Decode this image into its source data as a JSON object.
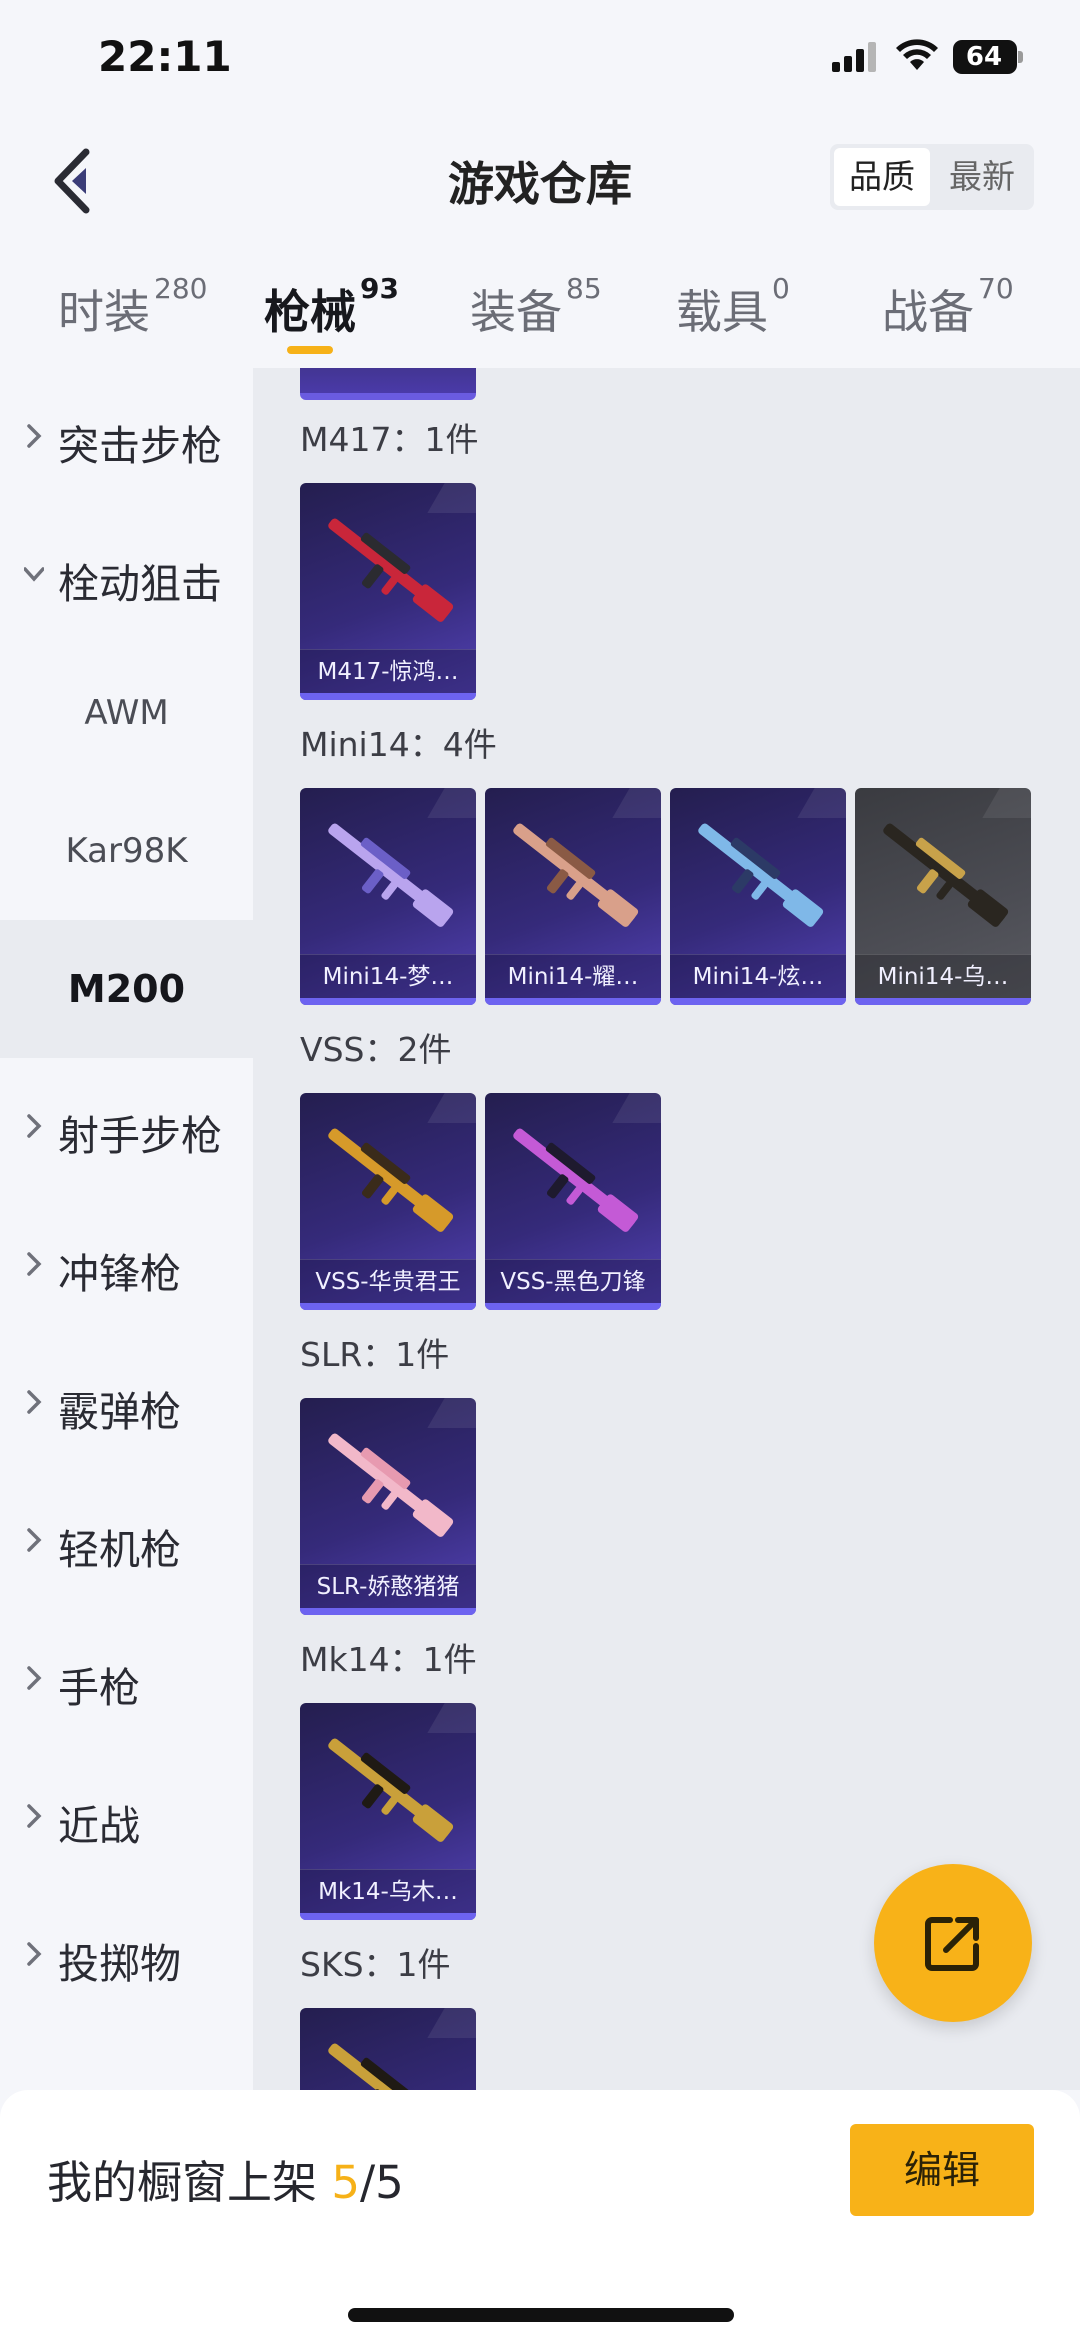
{
  "status_bar": {
    "time": "22:11",
    "battery": "64"
  },
  "header": {
    "title": "游戏仓库",
    "sort_options": [
      "品质",
      "最新"
    ],
    "sort_active": "品质"
  },
  "tabs": [
    {
      "label": "时装",
      "count": "280"
    },
    {
      "label": "枪械",
      "count": "93"
    },
    {
      "label": "装备",
      "count": "85"
    },
    {
      "label": "载具",
      "count": "0"
    },
    {
      "label": "战备",
      "count": "70"
    }
  ],
  "sidebar": {
    "groups": [
      {
        "label": "突击步枪",
        "expanded": false
      },
      {
        "label": "栓动狙击",
        "expanded": true
      },
      {
        "label": "射手步枪",
        "expanded": false
      },
      {
        "label": "冲锋枪",
        "expanded": false
      },
      {
        "label": "霰弹枪",
        "expanded": false
      },
      {
        "label": "轻机枪",
        "expanded": false
      },
      {
        "label": "手枪",
        "expanded": false
      },
      {
        "label": "近战",
        "expanded": false
      },
      {
        "label": "投掷物",
        "expanded": false
      }
    ],
    "subitems": [
      "AWM",
      "Kar98K",
      "M200"
    ],
    "active_subitem": "M200"
  },
  "sections": [
    {
      "label": "M417：1件",
      "items": [
        {
          "name": "M417-惊鸿…",
          "gun_color": "#c9263a",
          "accent": "#2b2b30"
        }
      ]
    },
    {
      "label": "Mini14：4件",
      "items": [
        {
          "name": "Mini14-梦…",
          "gun_color": "#b9a4ee",
          "accent": "#6b5fc7"
        },
        {
          "name": "Mini14-耀…",
          "gun_color": "#d9a08a",
          "accent": "#8a5a45"
        },
        {
          "name": "Mini14-炫…",
          "gun_color": "#7fb8e8",
          "accent": "#2c3a66"
        },
        {
          "name": "Mini14-乌…",
          "gun_color": "#2a2620",
          "accent": "#c8a24a",
          "grey": true
        }
      ]
    },
    {
      "label": "VSS：2件",
      "items": [
        {
          "name": "VSS-华贵君王",
          "gun_color": "#d69a2a",
          "accent": "#3a2b1a"
        },
        {
          "name": "VSS-黑色刀锋",
          "gun_color": "#c45ad6",
          "accent": "#1e1a2e"
        }
      ]
    },
    {
      "label": "SLR：1件",
      "items": [
        {
          "name": "SLR-娇憨猪猪",
          "gun_color": "#f2b8c9",
          "accent": "#e79ab0"
        }
      ]
    },
    {
      "label": "Mk14：1件",
      "items": [
        {
          "name": "Mk14-乌木…",
          "gun_color": "#c9a03a",
          "accent": "#1f1a14"
        }
      ]
    },
    {
      "label": "SKS：1件",
      "items": [
        {
          "name": "",
          "gun_color": "#c9a03a",
          "accent": "#1f1a14"
        }
      ]
    }
  ],
  "bottom_bar": {
    "showcase_label": "我的橱窗上架 ",
    "current": "5",
    "total": "/5",
    "edit_label": "编辑"
  },
  "colors": {
    "accent": "#f8b218",
    "card_dark": "#2b2463",
    "card_rim": "#6d63f0"
  }
}
